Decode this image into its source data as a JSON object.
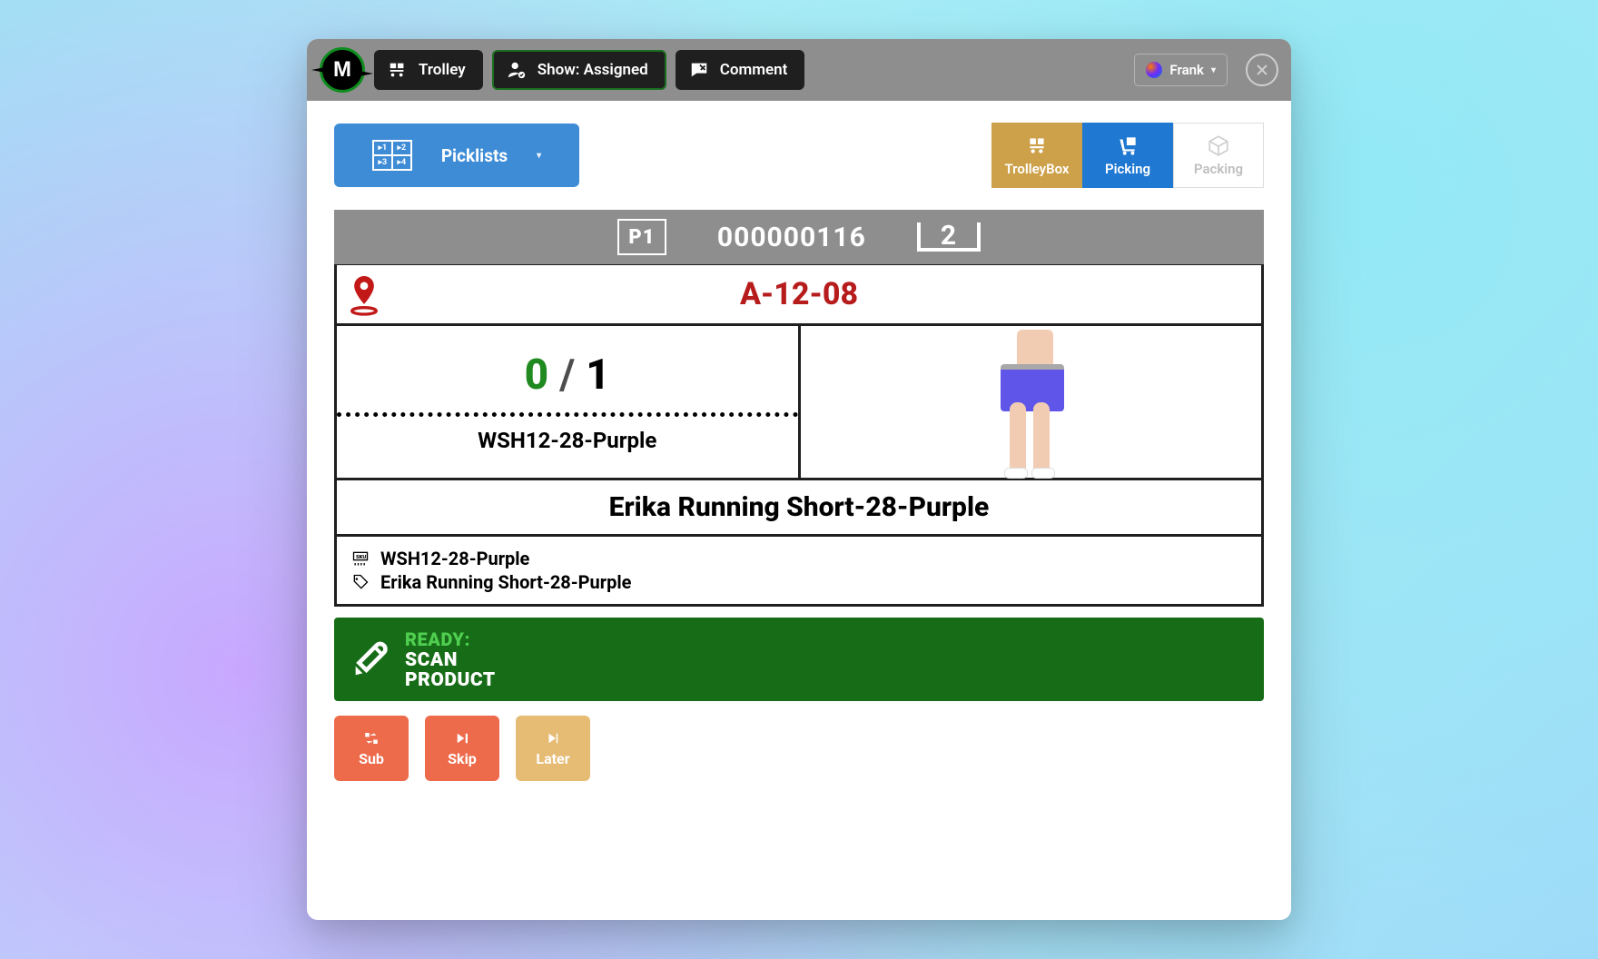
{
  "titlebar": {
    "trolley_label": "Trolley",
    "show_label": "Show: Assigned",
    "comment_label": "Comment",
    "username": "Frank"
  },
  "toolbar": {
    "picklists_label": "Picklists"
  },
  "modes": {
    "trolleybox": "TrolleyBox",
    "picking": "Picking",
    "packing": "Packing"
  },
  "pick": {
    "position_badge": "P1",
    "order_number": "000000116",
    "line_number": "2",
    "location": "A-12-08",
    "picked_qty": "0",
    "required_qty": "1",
    "sku": "WSH12-28-Purple",
    "product_name": "Erika Running Short-28-Purple"
  },
  "ready": {
    "title": "READY:",
    "line1": "SCAN",
    "line2": "PRODUCT"
  },
  "actions": {
    "sub": "Sub",
    "skip": "Skip",
    "later": "Later"
  }
}
